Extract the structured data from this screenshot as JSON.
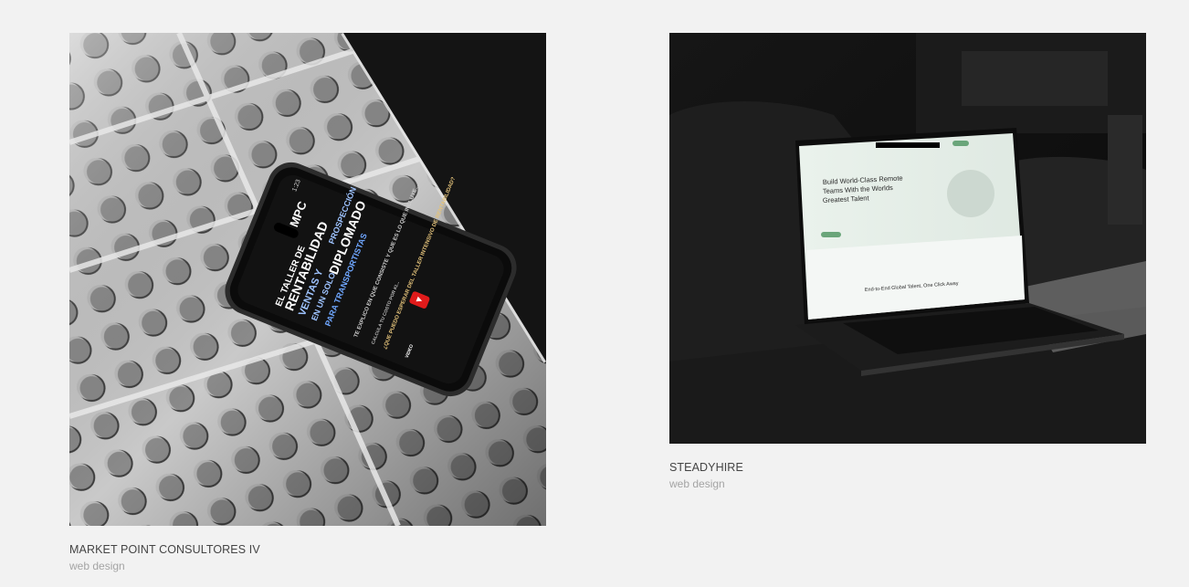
{
  "projects": [
    {
      "title": "MARKET POINT CONSULTORES IV",
      "category": "web design",
      "phone_screen": {
        "time": "1:23",
        "logo": "MPC",
        "headline_lines": [
          "EL TALLER DE",
          "RENTABILIDAD",
          "VENTAS Y",
          "PROSPECCIÓN",
          "EN UN SOLO",
          "DIPLOMADO",
          "PARA TRANSPORTISTAS"
        ],
        "intro": "TE EXPLICO EN QUE CONSISTE Y QUE ES LO QUE INCLUYE...",
        "calc_text": "CALCULA TU COSTO POR KI...",
        "question": "¿QUE PUEDO ESPERAR DEL TALLER INTENSIVO DE RENTABILIDAD?",
        "video_label": "VIDEO"
      }
    },
    {
      "title": "STEADYHIRE",
      "category": "web design",
      "laptop_screen": {
        "headline_lines": [
          "Build World-Class Remote",
          "Teams With the Worlds",
          "Greatest Talent"
        ],
        "footer_heading": "End-to-End Global Talent, One Click Away"
      }
    }
  ]
}
